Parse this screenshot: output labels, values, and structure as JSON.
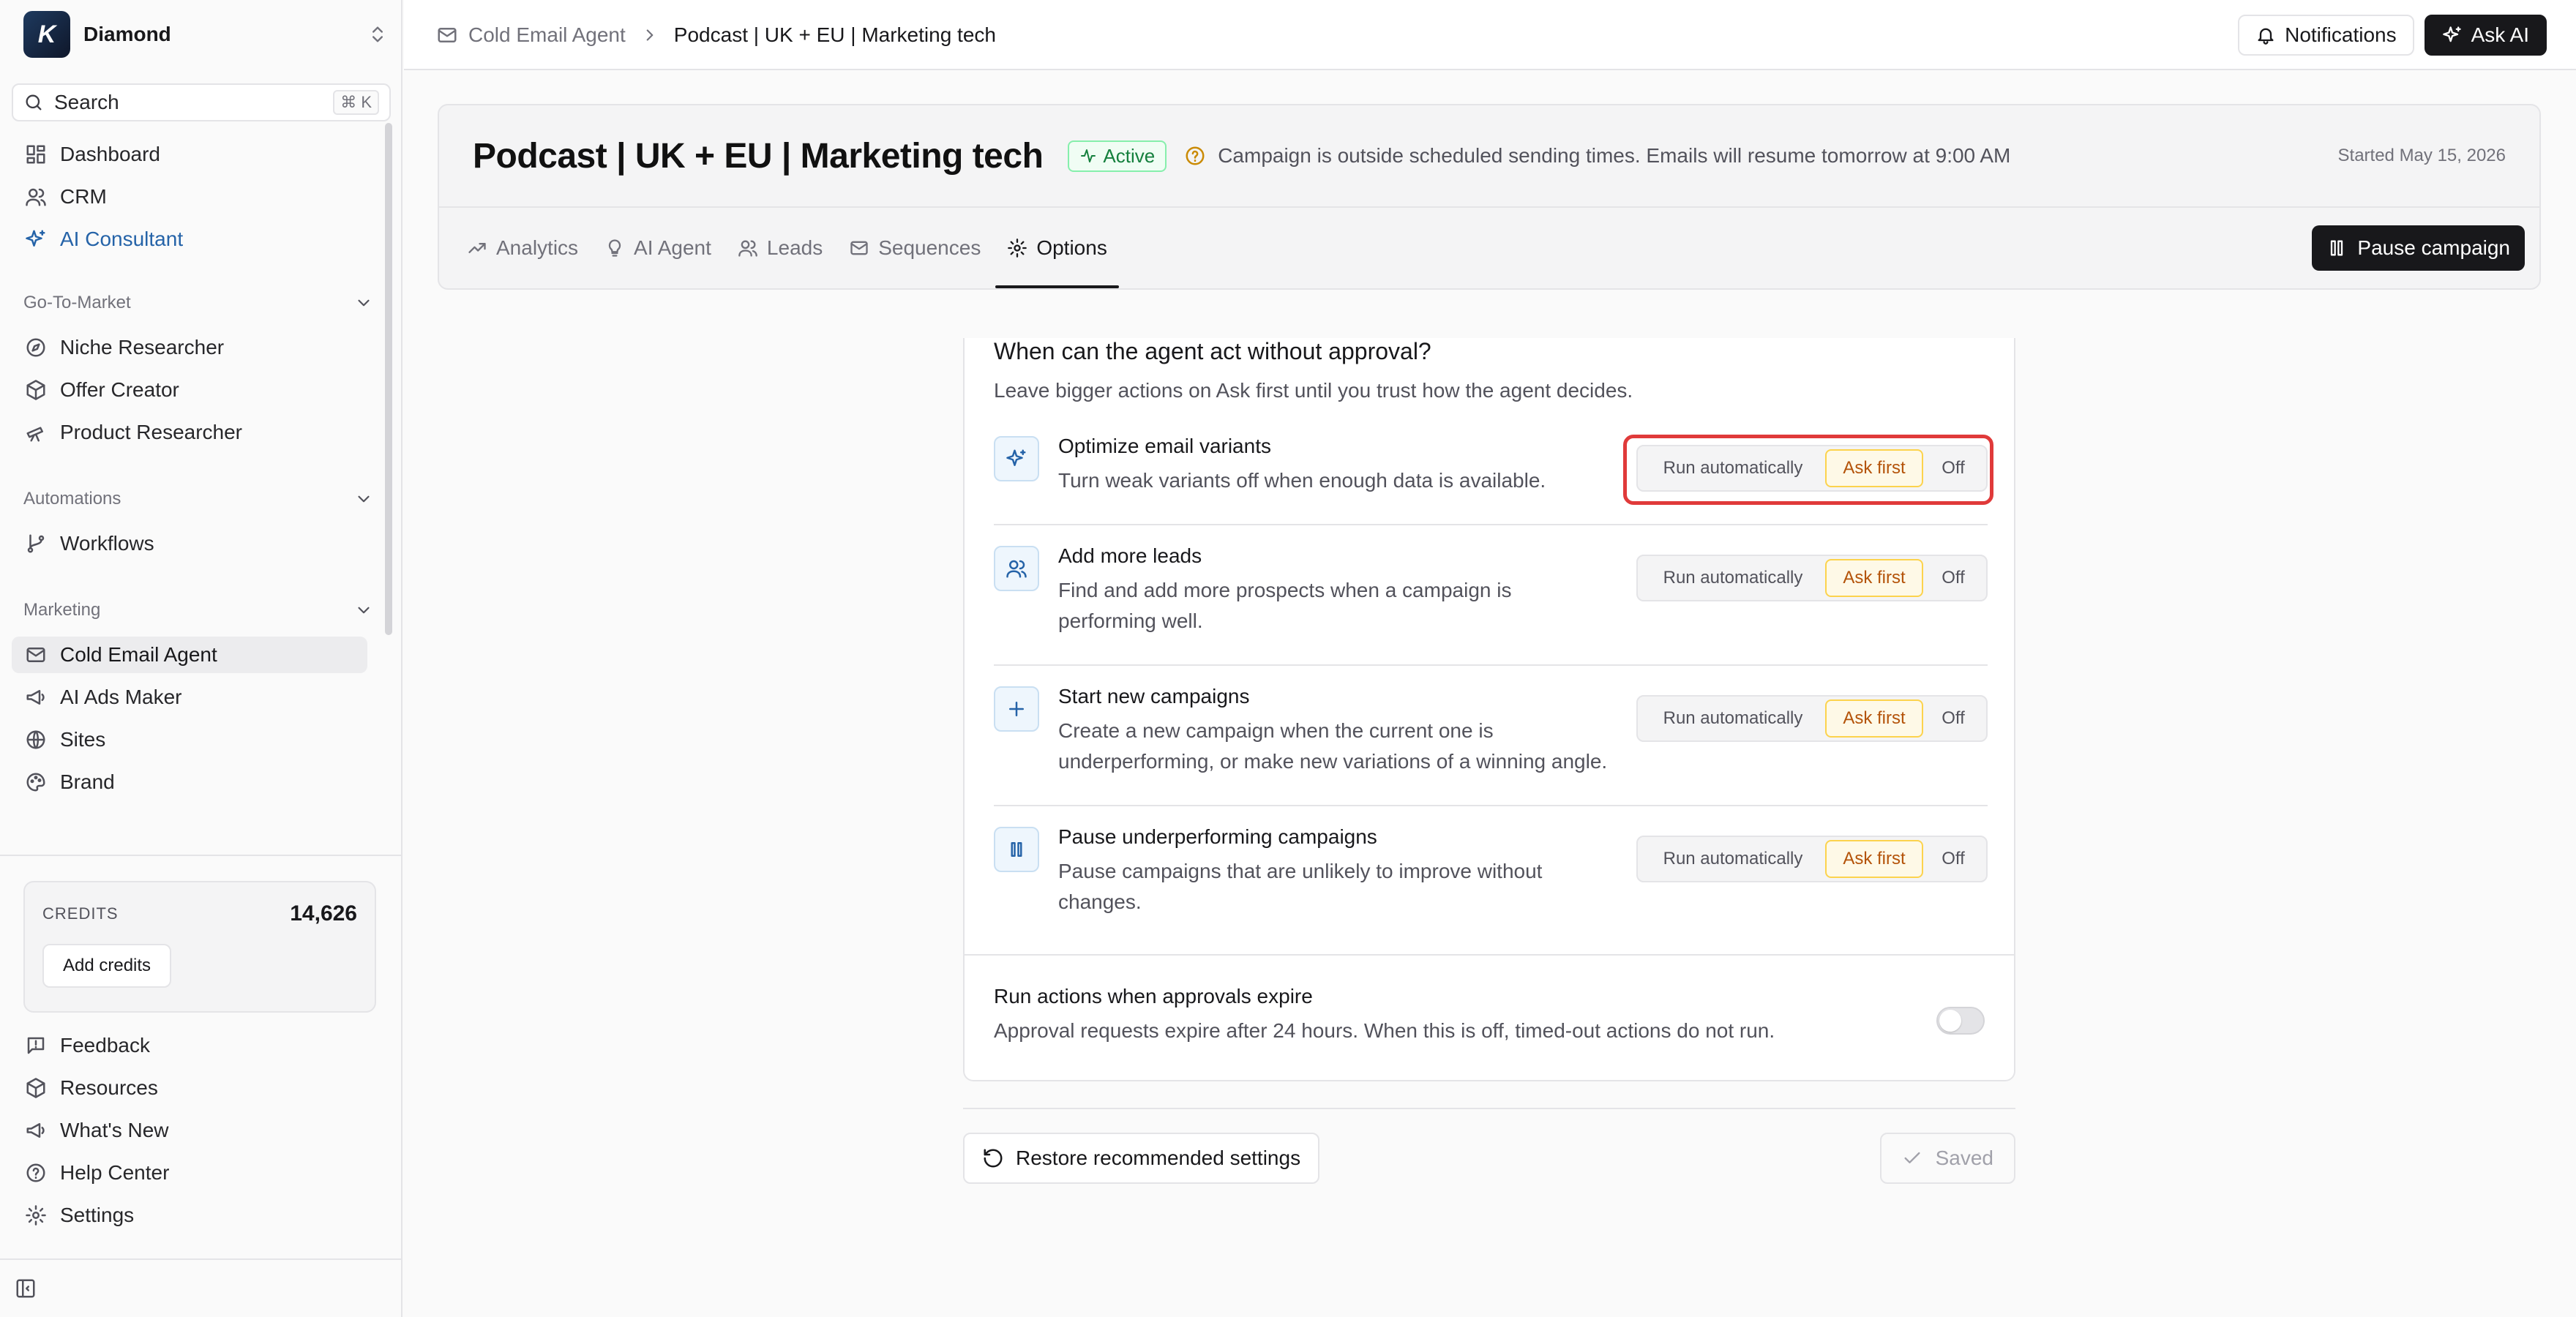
{
  "workspace": {
    "name": "Diamond",
    "logo_letter": "K"
  },
  "search": {
    "label": "Search",
    "shortcut": "⌘ K"
  },
  "nav_main": [
    {
      "label": "Dashboard",
      "icon": "dashboard-icon"
    },
    {
      "label": "CRM",
      "icon": "users-icon"
    },
    {
      "label": "AI Consultant",
      "icon": "sparkles-icon"
    }
  ],
  "sections": {
    "gtm": {
      "label": "Go-To-Market",
      "items": [
        "Niche Researcher",
        "Offer Creator",
        "Product Researcher"
      ]
    },
    "automations": {
      "label": "Automations",
      "items": [
        "Workflows"
      ]
    },
    "marketing": {
      "label": "Marketing",
      "items": [
        "Cold Email Agent",
        "AI Ads Maker",
        "Sites",
        "Brand"
      ]
    }
  },
  "credits": {
    "label": "CREDITS",
    "value": "14,626",
    "button": "Add credits"
  },
  "footer_nav": [
    "Feedback",
    "Resources",
    "What's New",
    "Help Center",
    "Settings"
  ],
  "breadcrumb": {
    "parent": "Cold Email Agent",
    "current": "Podcast | UK + EU | Marketing tech"
  },
  "topbar": {
    "notifications": "Notifications",
    "ask_ai": "Ask AI"
  },
  "campaign": {
    "title": "Podcast | UK + EU | Marketing tech",
    "status": "Active",
    "notice": "Campaign is outside scheduled sending times. Emails will resume tomorrow at 9:00 AM",
    "started": "Started May 15, 2026",
    "tabs": [
      "Analytics",
      "AI Agent",
      "Leads",
      "Sequences",
      "Options"
    ],
    "active_tab": "Options",
    "pause_button": "Pause campaign"
  },
  "options": {
    "heading": "When can the agent act without approval?",
    "subheading": "Leave bigger actions on Ask first until you trust how the agent decides.",
    "segment_labels": [
      "Run automatically",
      "Ask first",
      "Off"
    ],
    "items": [
      {
        "title": "Optimize email variants",
        "desc": "Turn weak variants off when enough data is available.",
        "value": "Ask first"
      },
      {
        "title": "Add more leads",
        "desc": "Find and add more prospects when a campaign is performing well.",
        "value": "Ask first"
      },
      {
        "title": "Start new campaigns",
        "desc": "Create a new campaign when the current one is underperforming, or make new variations of a winning angle.",
        "value": "Ask first"
      },
      {
        "title": "Pause underperforming campaigns",
        "desc": "Pause campaigns that are unlikely to improve without changes.",
        "value": "Ask first"
      }
    ],
    "expire": {
      "title": "Run actions when approvals expire",
      "desc": "Approval requests expire after 24 hours. When this is off, timed-out actions do not run.",
      "enabled": false
    }
  },
  "footer": {
    "restore": "Restore recommended settings",
    "saved": "Saved"
  },
  "colors": {
    "accent": "#2563a8",
    "active_badge": "#15803d",
    "ask_first": "#b45309",
    "highlight": "#e03a3a",
    "dark": "#18181b"
  }
}
